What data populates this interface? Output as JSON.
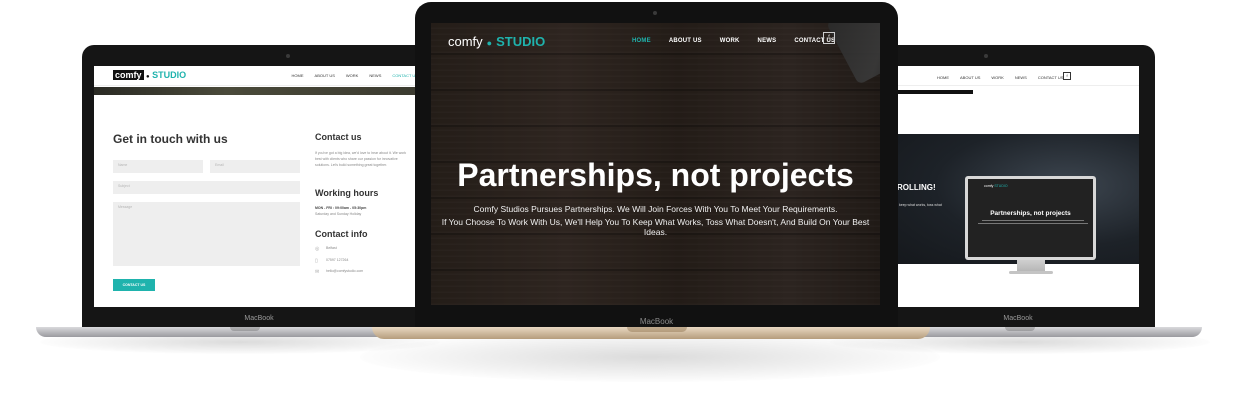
{
  "brand": {
    "word": "comfy",
    "studio": "STUDIO",
    "accent": "#1fb3ad"
  },
  "laptop_label": "MacBook",
  "center": {
    "nav": [
      "HOME",
      "ABOUT US",
      "WORK",
      "NEWS",
      "CONTACT US"
    ],
    "social": "f",
    "headline": "Partnerships, not projects",
    "sub_line_1": "Comfy Studios Pursues Partnerships. We Will Join Forces With You To Meet Your Requirements.",
    "sub_line_2": "If You Choose To Work With Us, We'll Help You To Keep What Works, Toss What Doesn't, And Build On Your Best Ideas."
  },
  "left": {
    "nav": [
      "HOME",
      "ABOUT US",
      "WORK",
      "NEWS",
      "CONTACT US"
    ],
    "title": "Get in touch with us",
    "form": {
      "name_placeholder": "Name",
      "email_placeholder": "Email",
      "subject_placeholder": "Subject",
      "message_placeholder": "Message",
      "submit": "CONTACT US"
    },
    "contact_heading": "Contact us",
    "contact_text": "If you've got a big idea, we'd love to hear about it. We work best with clients who share our passion for innovative solutions. Let's build something great together.",
    "hours_heading": "Working hours",
    "hours_line": "MON - FRI : 09:00am - 05:30pm",
    "hours_note": "Saturday and Sunday Holiday",
    "info_heading": "Contact info",
    "info_location": "Belfast",
    "info_phone": "07597 127264",
    "info_email": "hello@comfystudio.com"
  },
  "right": {
    "nav": [
      "HOME",
      "ABOUT US",
      "WORK",
      "NEWS",
      "CONTACT US"
    ],
    "social": "f",
    "hero_heading": "ROLLING!",
    "hero_text": "keep what works, toss what",
    "monitor_title": "Partnerships, not projects"
  }
}
